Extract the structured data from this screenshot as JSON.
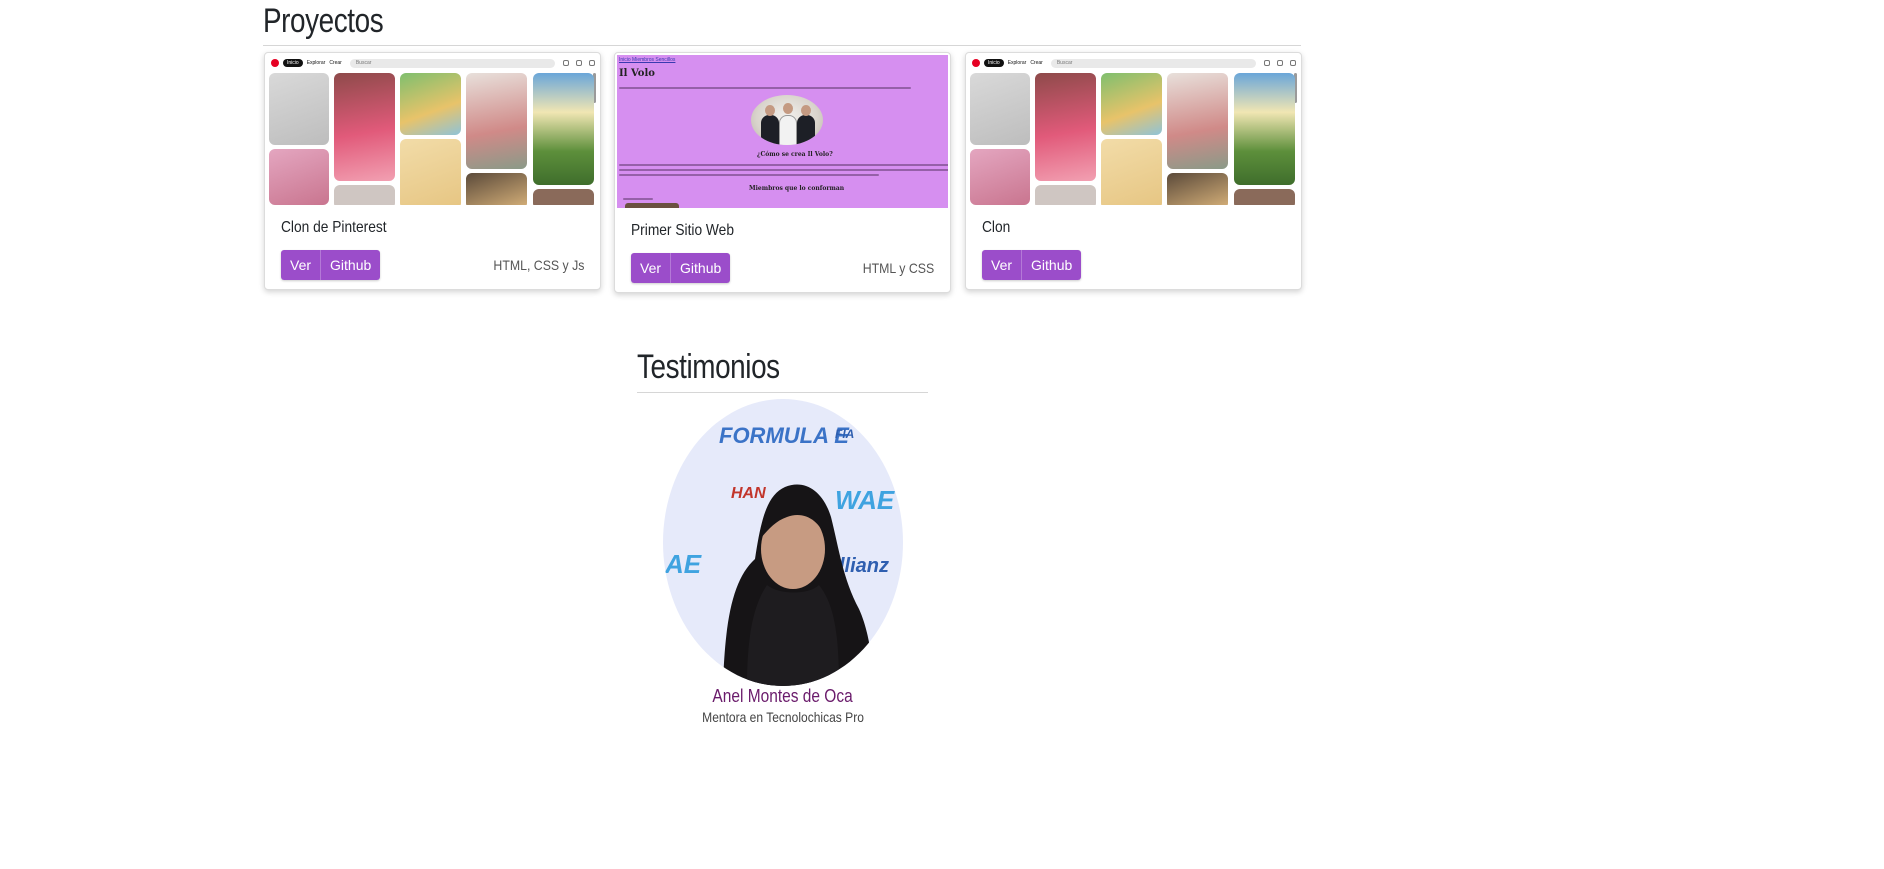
{
  "projects_section": {
    "title": "Proyectos"
  },
  "projects": [
    {
      "title": "Clon de Pinterest",
      "tech": "HTML, CSS y Js",
      "view_label": "Ver",
      "github_label": "Github",
      "preview": "pinterest"
    },
    {
      "title": "Primer Sitio Web",
      "tech": "HTML y CSS",
      "view_label": "Ver",
      "github_label": "Github",
      "preview": "il-volo"
    },
    {
      "title": "Clon",
      "tech": "",
      "view_label": "Ver",
      "github_label": "Github",
      "preview": "pinterest"
    }
  ],
  "pinterest_preview": {
    "nav_home": "Inicio",
    "nav_explore": "Explorar",
    "nav_create": "Crear",
    "search_placeholder": "Buscar"
  },
  "volo_preview": {
    "links": "Inicio Miembros Sencillos",
    "heading": "Il Volo",
    "subheading_1": "¿Cómo se crea Il Volo?",
    "subheading_2": "Miembros que lo conforman"
  },
  "testimonials_section": {
    "title": "Testimonios"
  },
  "testimonial": {
    "name": "Anel Montes de Oca",
    "role": "Mentora en Tecnolochicas Pro",
    "backdrop_logos": [
      "FORMULA E",
      "FIA",
      "HAN",
      "WAE",
      "AE",
      "llianz"
    ]
  },
  "colors": {
    "accent": "#9b4dca",
    "name_color": "#6a1b6b",
    "volo_bg": "#d68ff0"
  }
}
